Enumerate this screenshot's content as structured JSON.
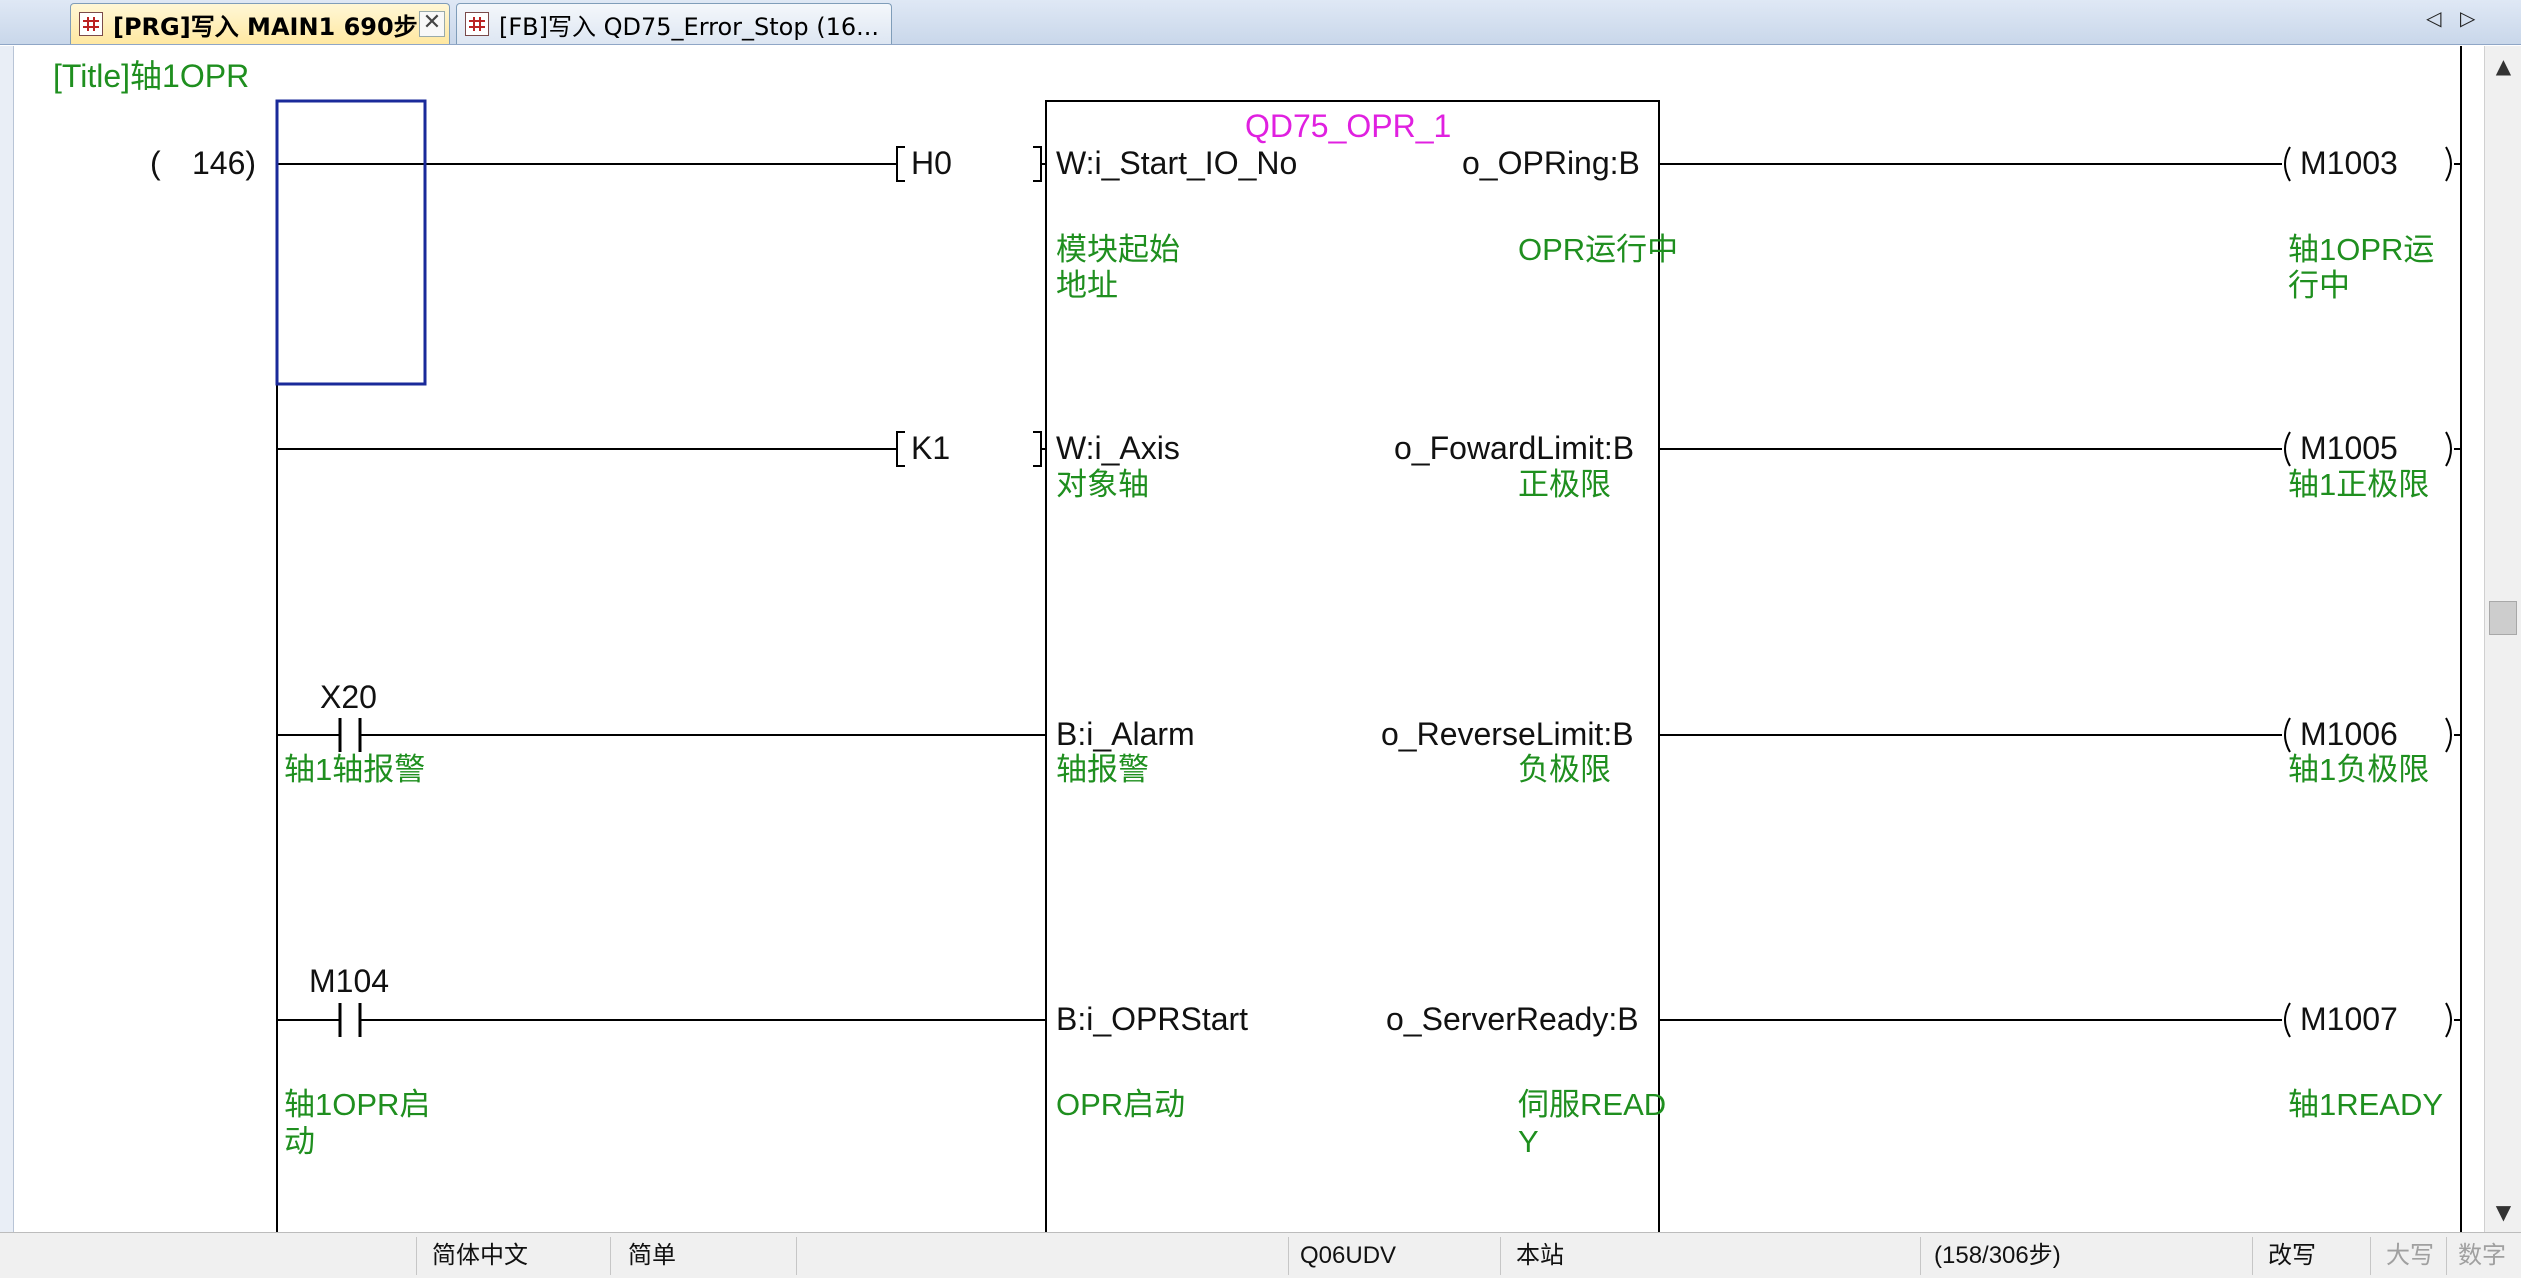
{
  "tabs": [
    {
      "label": "[PRG]写入 MAIN1 690步",
      "active": true,
      "close": "✕"
    },
    {
      "label": "[FB]写入 QD75_Error_Stop (16...",
      "active": false
    }
  ],
  "nav": {
    "left": "◁",
    "right": "▷"
  },
  "scrollbar": {
    "up": "▲",
    "down": "▼"
  },
  "ladder": {
    "title": "[Title]轴1OPR",
    "step_paren": "(",
    "step_number": "146)",
    "fb_instance": "QD75_OPR_1",
    "constants": [
      {
        "value": "H0",
        "pin": "W:i_Start_IO_No",
        "comment_1": "模块起始",
        "comment_2": "地址"
      },
      {
        "value": "K1",
        "pin": "W:i_Axis",
        "comment_1": "对象轴"
      }
    ],
    "contacts": [
      {
        "device": "X20",
        "pin": "B:i_Alarm",
        "comment": "轴1轴报警",
        "pin_comment": "轴报警"
      },
      {
        "device": "M104",
        "pin": "B:i_OPRStart",
        "comment_1": "轴1OPR启",
        "comment_2": "动",
        "pin_comment": "OPR启动"
      }
    ],
    "outputs": [
      {
        "pin": "o_OPRing:B",
        "pin_comment": "OPR运行中",
        "coil": "M1003",
        "coil_comment_1": "轴1OPR运",
        "coil_comment_2": "行中"
      },
      {
        "pin": "o_FowardLimit:B",
        "pin_comment": "正极限",
        "coil": "M1005",
        "coil_comment_1": "轴1正极限"
      },
      {
        "pin": "o_ReverseLimit:B",
        "pin_comment": "负极限",
        "coil": "M1006",
        "coil_comment_1": "轴1负极限"
      },
      {
        "pin": "o_ServerReady:B",
        "pin_comment_1": "伺服READ",
        "pin_comment_2": "Y",
        "coil": "M1007",
        "coil_comment_1": "轴1READY"
      }
    ]
  },
  "status": {
    "language": "简体中文",
    "mode": "简单",
    "cpu": "Q06UDV",
    "station": "本站",
    "steps": "(158/306步)",
    "overwrite": "改写",
    "caps": "大写",
    "numlock": "数字"
  },
  "colors": {
    "comment": "#1f8f1f",
    "instance": "#e020e0",
    "cursor": "#1a2a9a",
    "line": "#000000"
  }
}
